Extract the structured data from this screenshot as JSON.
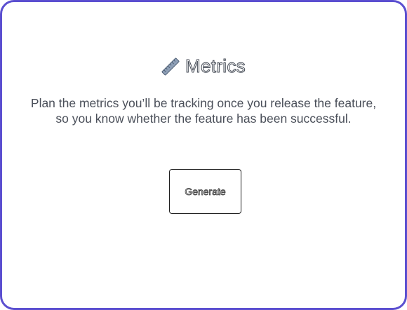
{
  "card": {
    "title": "Metrics",
    "title_icon": "ruler-icon",
    "description": "Plan the metrics you’ll be tracking once you release the feature, so you know whether the feature has been successful.",
    "generate_label": "Generate"
  },
  "colors": {
    "card_border": "#5b4fd0",
    "text": "#4a4f59"
  }
}
